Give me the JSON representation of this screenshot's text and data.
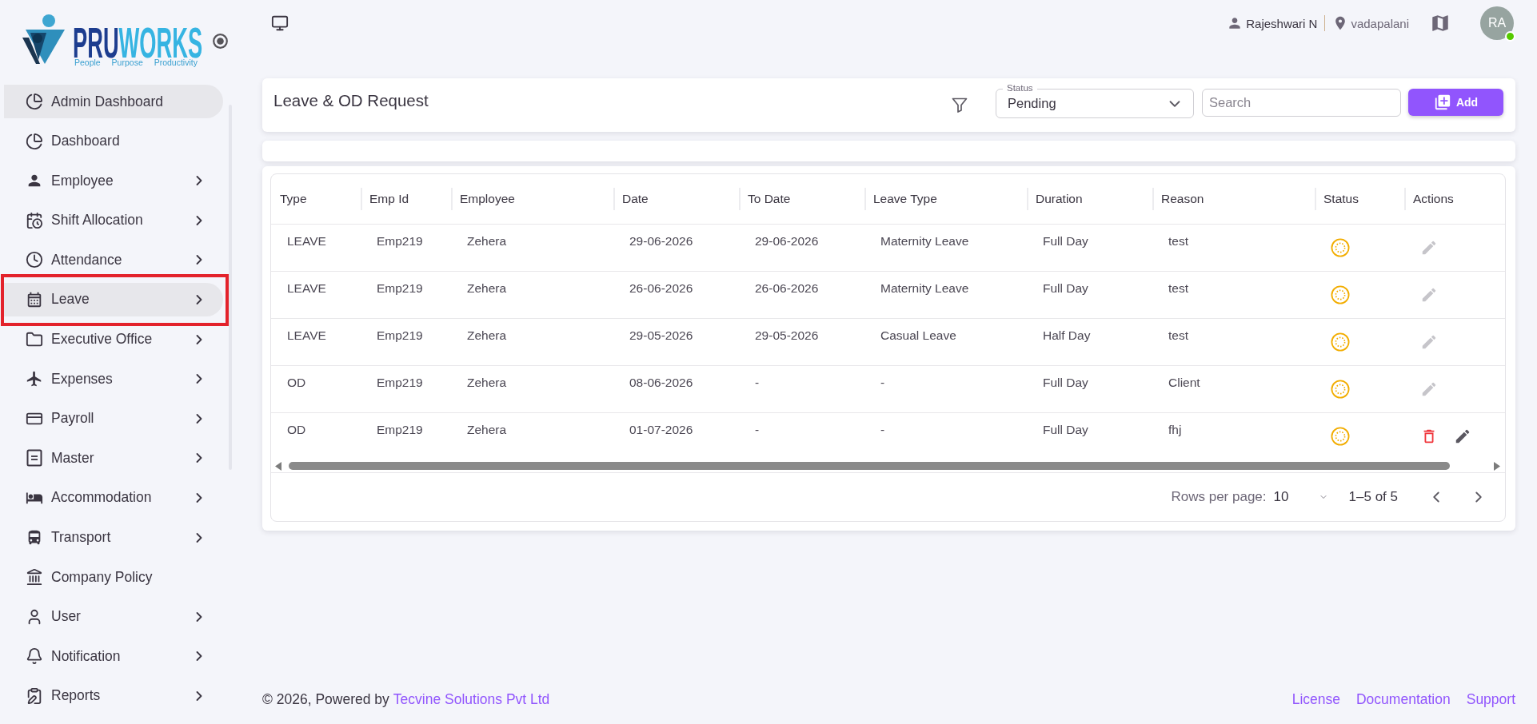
{
  "logo": {
    "wordmark": [
      {
        "text": "PRU",
        "color": "#1d3d8f"
      },
      {
        "text": "WORKS",
        "color": "#36b4e2"
      }
    ],
    "tagline": "People Purpose Productivity"
  },
  "sidebar": {
    "items": [
      {
        "label": "Admin Dashboard",
        "selected": true,
        "has_submenu": false,
        "highlighted": false
      },
      {
        "label": "Dashboard",
        "selected": false,
        "has_submenu": false,
        "highlighted": false
      },
      {
        "label": "Employee",
        "selected": false,
        "has_submenu": true,
        "highlighted": false
      },
      {
        "label": "Shift Allocation",
        "selected": false,
        "has_submenu": true,
        "highlighted": false
      },
      {
        "label": "Attendance",
        "selected": false,
        "has_submenu": true,
        "highlighted": false
      },
      {
        "label": "Leave",
        "selected": true,
        "has_submenu": true,
        "highlighted": true
      },
      {
        "label": "Executive Office",
        "selected": false,
        "has_submenu": true,
        "highlighted": false
      },
      {
        "label": "Expenses",
        "selected": false,
        "has_submenu": true,
        "highlighted": false
      },
      {
        "label": "Payroll",
        "selected": false,
        "has_submenu": true,
        "highlighted": false
      },
      {
        "label": "Master",
        "selected": false,
        "has_submenu": true,
        "highlighted": false
      },
      {
        "label": "Accommodation",
        "selected": false,
        "has_submenu": true,
        "highlighted": false
      },
      {
        "label": "Transport",
        "selected": false,
        "has_submenu": true,
        "highlighted": false
      },
      {
        "label": "Company Policy",
        "selected": false,
        "has_submenu": false,
        "highlighted": false
      },
      {
        "label": "User",
        "selected": false,
        "has_submenu": true,
        "highlighted": false
      },
      {
        "label": "Notification",
        "selected": false,
        "has_submenu": true,
        "highlighted": false
      },
      {
        "label": "Reports",
        "selected": false,
        "has_submenu": true,
        "highlighted": false
      }
    ]
  },
  "topbar": {
    "user_name": "Rajeshwari N",
    "location": "vadapalani",
    "avatar_initials": "RA",
    "online": true
  },
  "request_panel": {
    "title": "Leave & OD Request",
    "status_filter": {
      "label": "Status",
      "value": "Pending"
    },
    "search": {
      "placeholder": "Search"
    },
    "add_button": "Add"
  },
  "table": {
    "columns": [
      "Type",
      "Emp Id",
      "Employee",
      "Date",
      "To Date",
      "Leave Type",
      "Duration",
      "Reason",
      "Status",
      "Actions"
    ],
    "rows": [
      {
        "cells": [
          "LEAVE",
          "Emp219",
          "Zehera",
          "29-06-2026",
          "29-06-2026",
          "Maternity Leave",
          "Full Day",
          "test"
        ],
        "pending": true,
        "edit_disabled": true,
        "deletable": false
      },
      {
        "cells": [
          "LEAVE",
          "Emp219",
          "Zehera",
          "26-06-2026",
          "26-06-2026",
          "Maternity Leave",
          "Full Day",
          "test"
        ],
        "pending": true,
        "edit_disabled": true,
        "deletable": false
      },
      {
        "cells": [
          "LEAVE",
          "Emp219",
          "Zehera",
          "29-05-2026",
          "29-05-2026",
          "Casual Leave",
          "Half Day",
          "test"
        ],
        "pending": true,
        "edit_disabled": true,
        "deletable": false
      },
      {
        "cells": [
          "OD",
          "Emp219",
          "Zehera",
          "08-06-2026",
          "-",
          "-",
          "Full Day",
          "Client"
        ],
        "pending": true,
        "edit_disabled": true,
        "deletable": false
      },
      {
        "cells": [
          "OD",
          "Emp219",
          "Zehera",
          "01-07-2026",
          "-",
          "-",
          "Full Day",
          "fhj"
        ],
        "pending": true,
        "edit_disabled": false,
        "deletable": true
      }
    ]
  },
  "pagination": {
    "rows_per_page_label": "Rows per page:",
    "rows_per_page": "10",
    "range": "1–5 of 5"
  },
  "footer": {
    "copyright": "© 2026, Powered by",
    "company": "Tecvine Solutions Pvt Ltd",
    "links": [
      "License",
      "Documentation",
      "Support"
    ]
  }
}
